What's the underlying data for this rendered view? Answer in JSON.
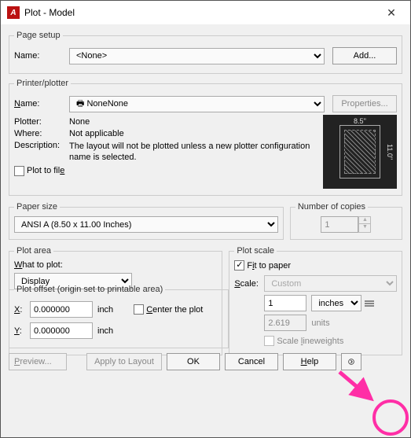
{
  "window": {
    "title": "Plot - Model"
  },
  "pageSetup": {
    "legend": "Page setup",
    "nameLabel": "Name:",
    "nameValue": "<None>",
    "addBtn": "Add..."
  },
  "printer": {
    "legend": "Printer/plotter",
    "nameLabel": "Name:",
    "nameValue": "None",
    "propsBtn": "Properties...",
    "plotterLabel": "Plotter:",
    "plotterValue": "None",
    "whereLabel": "Where:",
    "whereValue": "Not applicable",
    "descLabel": "Description:",
    "descValue": "The layout will not be plotted unless a new plotter configuration name is selected.",
    "plotToFile": "Plot to file",
    "paperW": "8.5''",
    "paperH": "11.0''"
  },
  "paperSize": {
    "legend": "Paper size",
    "value": "ANSI A (8.50 x 11.00 Inches)"
  },
  "copies": {
    "legend": "Number of copies",
    "value": "1"
  },
  "plotArea": {
    "legend": "Plot area",
    "whatLabel": "What to plot:",
    "value": "Display"
  },
  "plotScale": {
    "legend": "Plot scale",
    "fitLabel": "Fit to paper",
    "scaleLabel": "Scale:",
    "scaleValue": "Custom",
    "num": "1",
    "unitSel": "inches",
    "den": "2.619",
    "denUnit": "units",
    "lineweights": "Scale lineweights"
  },
  "plotOffset": {
    "legend": "Plot offset (origin set to printable area)",
    "xLabel": "X:",
    "xValue": "0.000000",
    "xUnit": "inch",
    "yLabel": "Y:",
    "yValue": "0.000000",
    "yUnit": "inch",
    "centerLabel": "Center the plot"
  },
  "buttons": {
    "preview": "Preview...",
    "apply": "Apply to Layout",
    "ok": "OK",
    "cancel": "Cancel",
    "help": "Help"
  }
}
